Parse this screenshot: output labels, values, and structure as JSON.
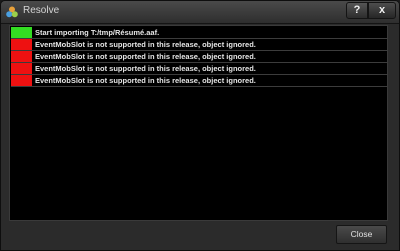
{
  "window": {
    "title": "Resolve",
    "help_label": "?",
    "close_icon_label": "x"
  },
  "log": {
    "rows": [
      {
        "status": "success",
        "color": "#33dd22",
        "message": "Start importing T:/tmp/Résumé.aaf."
      },
      {
        "status": "error",
        "color": "#ee1111",
        "message": "EventMobSlot is not supported in this release, object ignored."
      },
      {
        "status": "error",
        "color": "#ee1111",
        "message": "EventMobSlot is not supported in this release, object ignored."
      },
      {
        "status": "error",
        "color": "#ee1111",
        "message": "EventMobSlot is not supported in this release, object ignored."
      },
      {
        "status": "error",
        "color": "#ee1111",
        "message": "EventMobSlot is not supported in this release, object ignored."
      }
    ]
  },
  "footer": {
    "close_label": "Close"
  }
}
